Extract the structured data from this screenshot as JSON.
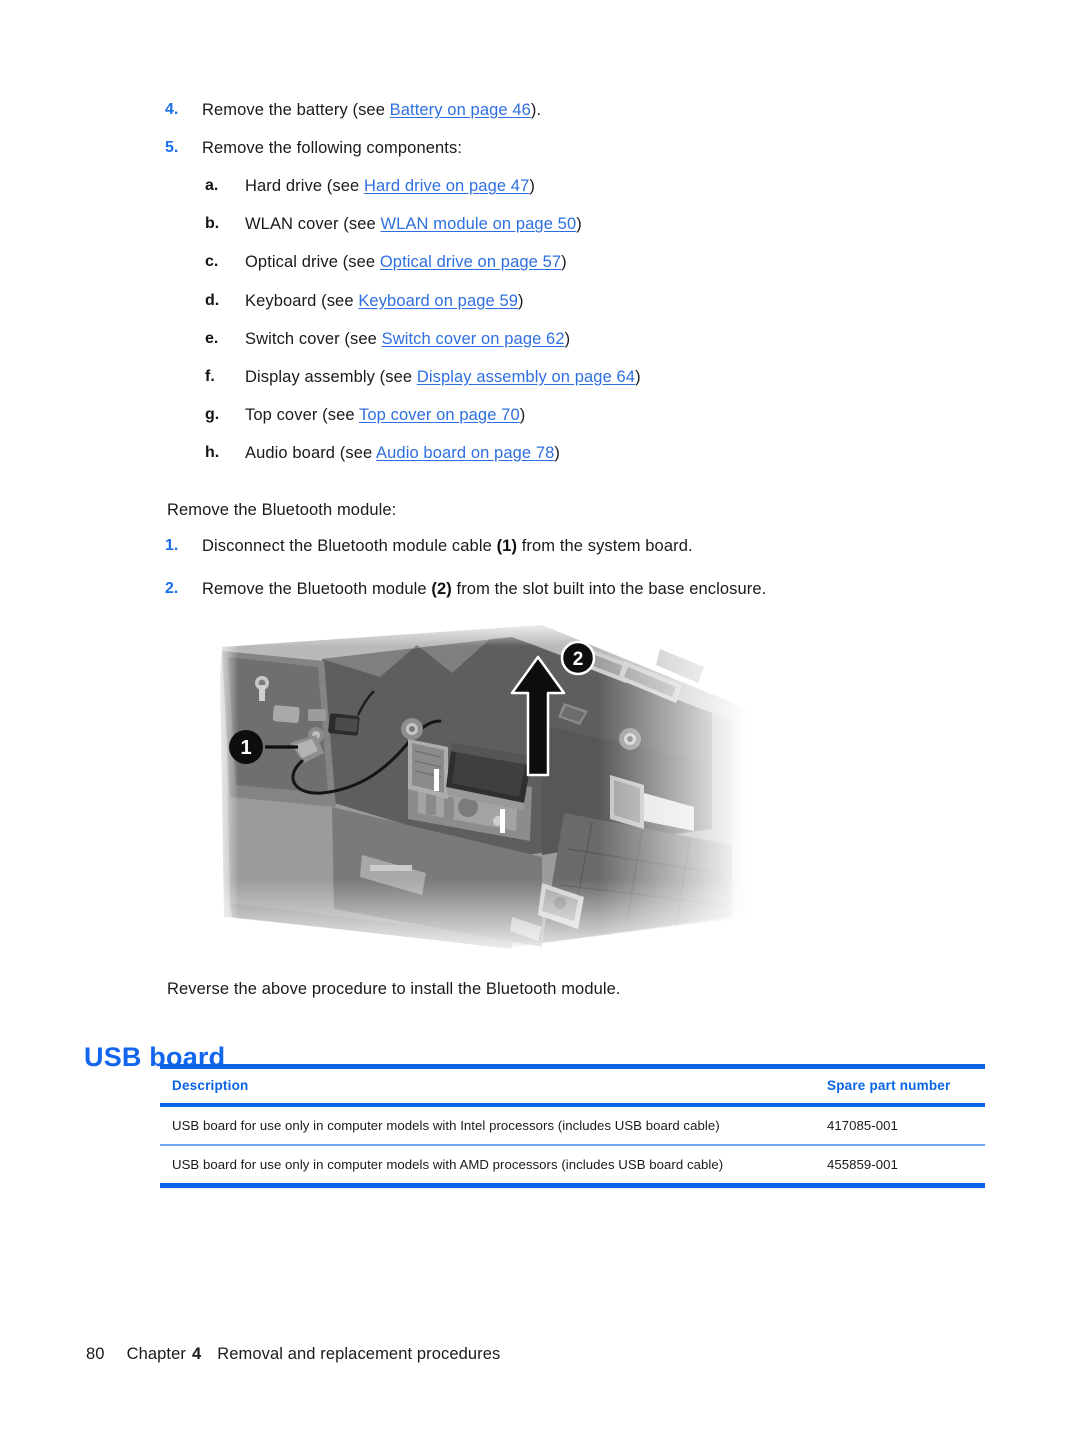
{
  "document": {
    "page_number": "80",
    "footer": {
      "chapter_label": "Chapter",
      "chapter_number": "4",
      "chapter_title": "Removal and replacement procedures"
    }
  },
  "steps_top": [
    {
      "marker": "4.",
      "text_before": "Remove the battery (see ",
      "link": "Battery on page 46",
      "text_after": ")."
    },
    {
      "marker": "5.",
      "text_before": "Remove the following components:",
      "link": "",
      "text_after": ""
    }
  ],
  "substeps": [
    {
      "marker": "a.",
      "text_before": "Hard drive (see ",
      "link": "Hard drive on page 47",
      "text_after": ")"
    },
    {
      "marker": "b.",
      "text_before": "WLAN cover (see ",
      "link": "WLAN module on page 50",
      "text_after": ")"
    },
    {
      "marker": "c.",
      "text_before": "Optical drive (see ",
      "link": "Optical drive on page 57",
      "text_after": ")"
    },
    {
      "marker": "d.",
      "text_before": "Keyboard (see ",
      "link": "Keyboard on page 59",
      "text_after": ")"
    },
    {
      "marker": "e.",
      "text_before": "Switch cover (see ",
      "link": "Switch cover on page 62",
      "text_after": ")"
    },
    {
      "marker": "f.",
      "text_before": "Display assembly (see ",
      "link": "Display assembly on page 64",
      "text_after": ")"
    },
    {
      "marker": "g.",
      "text_before": "Top cover (see ",
      "link": "Top cover on page 70",
      "text_after": ")"
    },
    {
      "marker": "h.",
      "text_before": "Audio board (see ",
      "link": "Audio board on page 78",
      "text_after": ")"
    }
  ],
  "intro_paragraph": "Remove the Bluetooth module:",
  "steps_bottom": [
    {
      "marker": "1.",
      "part1": "Disconnect the Bluetooth module cable ",
      "callout": "(1)",
      "part2": " from the system board."
    },
    {
      "marker": "2.",
      "part1": "Remove the Bluetooth module ",
      "callout": "(2)",
      "part2": " from the slot built into the base enclosure."
    }
  ],
  "closing_paragraph": "Reverse the above procedure to install the Bluetooth module.",
  "figure": {
    "alt": "Photograph of laptop base enclosure showing Bluetooth module removal",
    "callouts": [
      {
        "label": "1",
        "meaning": "bluetooth-module-cable-connector"
      },
      {
        "label": "2",
        "meaning": "bluetooth-module-lift-direction"
      }
    ]
  },
  "section": {
    "heading": "USB board"
  },
  "table": {
    "columns": [
      "Description",
      "Spare part number"
    ],
    "rows": [
      {
        "description": "USB board for use only in computer models with Intel processors (includes USB board cable)",
        "spare_part_number": "417085-001"
      },
      {
        "description": "USB board for use only in computer models with AMD processors (includes USB board cable)",
        "spare_part_number": "455859-001"
      }
    ]
  },
  "colors": {
    "link": "#2e6fe0",
    "marker_blue": "#1a6fe8",
    "heading_blue": "#1266ee",
    "table_rule": "#0a64e6",
    "row_rule": "#6fa8ee"
  }
}
